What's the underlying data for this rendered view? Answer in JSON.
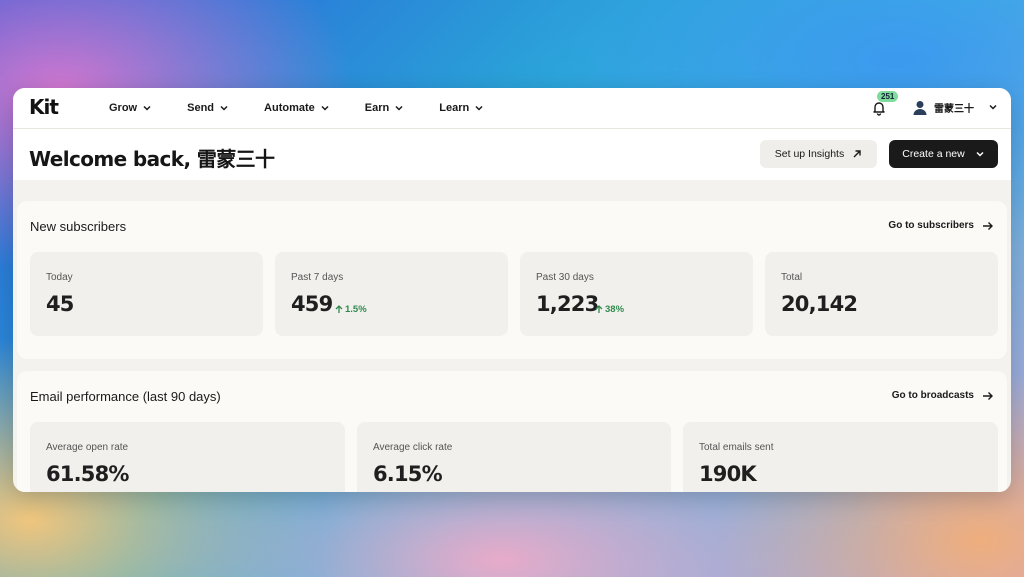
{
  "nav": {
    "logo": "Kit",
    "items": [
      "Grow",
      "Send",
      "Automate",
      "Earn",
      "Learn"
    ],
    "notifications_count": "251",
    "user_name": "雷蒙三十"
  },
  "header": {
    "welcome": "Welcome back, 雷蒙三十",
    "insights_button": "Set up Insights",
    "create_button": "Create a new"
  },
  "subscribers": {
    "title": "New subscribers",
    "link": "Go to subscribers",
    "cards": [
      {
        "label": "Today",
        "value": "45",
        "delta": ""
      },
      {
        "label": "Past 7 days",
        "value": "459",
        "delta": "1.5%"
      },
      {
        "label": "Past 30 days",
        "value": "1,223",
        "delta": "38%"
      },
      {
        "label": "Total",
        "value": "20,142",
        "delta": ""
      }
    ]
  },
  "email_performance": {
    "title": "Email performance (last 90 days)",
    "link": "Go to broadcasts",
    "cards": [
      {
        "label": "Average open rate",
        "value": "61.58%"
      },
      {
        "label": "Average click rate",
        "value": "6.15%"
      },
      {
        "label": "Total emails sent",
        "value": "190K"
      }
    ]
  },
  "colors": {
    "accent_dark": "#1a1a1a",
    "positive": "#2f8a4d",
    "badge": "#7fdc9c"
  }
}
